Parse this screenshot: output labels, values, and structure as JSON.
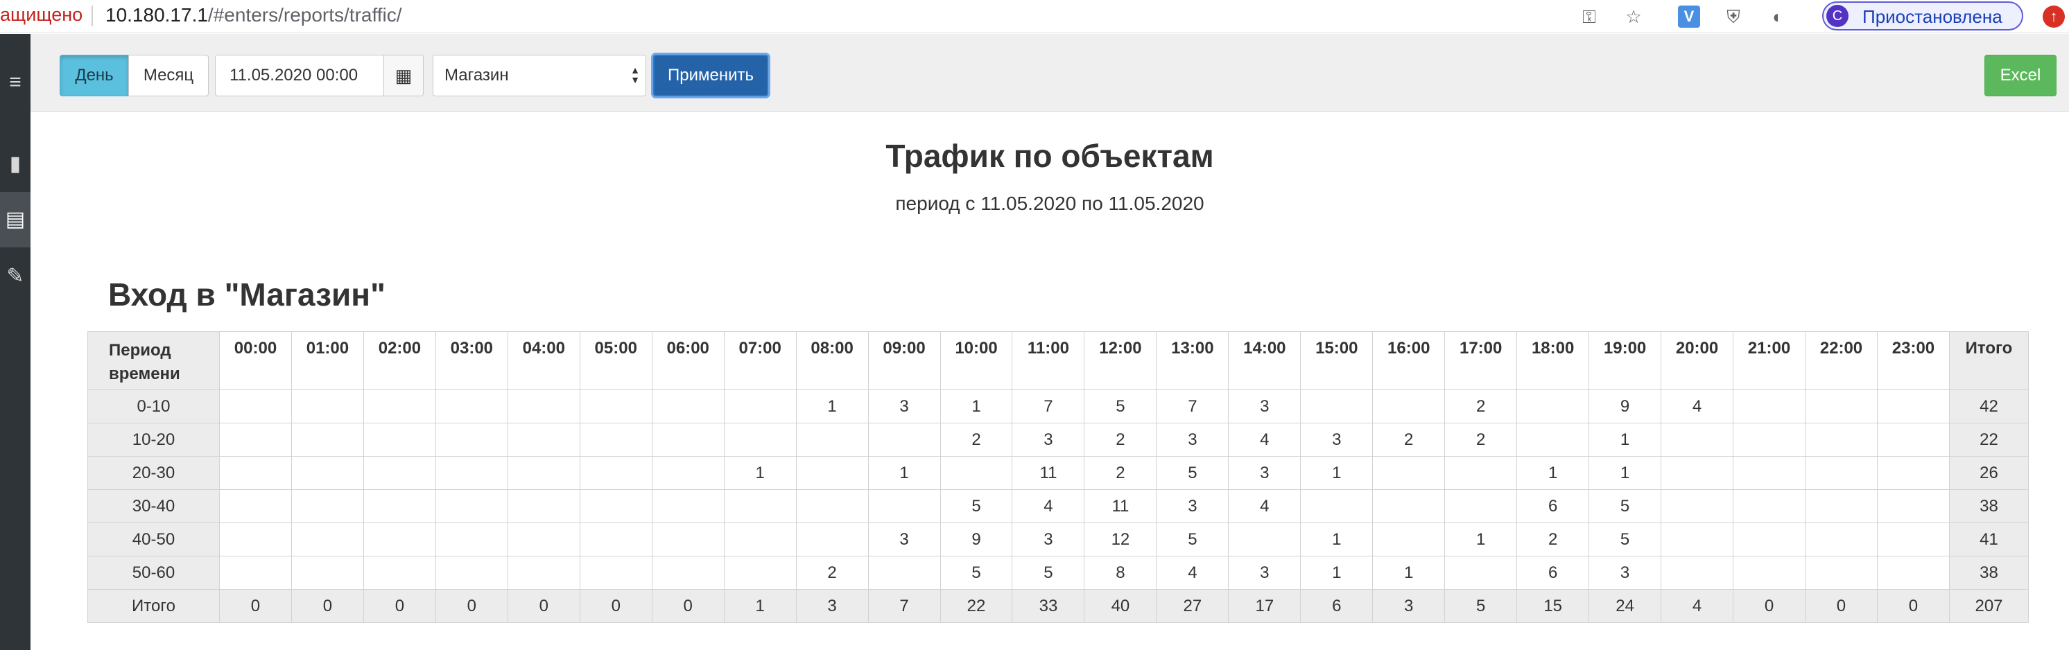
{
  "browser": {
    "security_label": "ащищено",
    "url_host": "10.180.17.1",
    "url_path": "/#enters/reports/traffic/",
    "profile_initial": "С",
    "profile_label": "Приостановлена",
    "ext_v_label": "V"
  },
  "toolbar": {
    "day_label": "День",
    "month_label": "Месяц",
    "date_value": "11.05.2020 00:00",
    "select_value": "Магазин",
    "apply_label": "Применить",
    "excel_label": "Excel"
  },
  "report": {
    "title": "Трафик по объектам",
    "subtitle": "период с 11.05.2020 по 11.05.2020",
    "section_title": "Вход в \"Магазин\""
  },
  "table": {
    "period_header_line1": "Период",
    "period_header_line2": "времени",
    "hours": [
      "00:00",
      "01:00",
      "02:00",
      "03:00",
      "04:00",
      "05:00",
      "06:00",
      "07:00",
      "08:00",
      "09:00",
      "10:00",
      "11:00",
      "12:00",
      "13:00",
      "14:00",
      "15:00",
      "16:00",
      "17:00",
      "18:00",
      "19:00",
      "20:00",
      "21:00",
      "22:00",
      "23:00"
    ],
    "total_header": "Итого",
    "rows": [
      {
        "label": "0-10",
        "cells": [
          "",
          "",
          "",
          "",
          "",
          "",
          "",
          "",
          "1",
          "3",
          "1",
          "7",
          "5",
          "7",
          "3",
          "",
          "",
          "2",
          "",
          "9",
          "4",
          "",
          "",
          ""
        ],
        "total": "42"
      },
      {
        "label": "10-20",
        "cells": [
          "",
          "",
          "",
          "",
          "",
          "",
          "",
          "",
          "",
          "",
          "2",
          "3",
          "2",
          "3",
          "4",
          "3",
          "2",
          "2",
          "",
          "1",
          "",
          "",
          "",
          ""
        ],
        "total": "22"
      },
      {
        "label": "20-30",
        "cells": [
          "",
          "",
          "",
          "",
          "",
          "",
          "",
          "1",
          "",
          "1",
          "",
          "11",
          "2",
          "5",
          "3",
          "1",
          "",
          "",
          "1",
          "1",
          "",
          "",
          "",
          ""
        ],
        "total": "26"
      },
      {
        "label": "30-40",
        "cells": [
          "",
          "",
          "",
          "",
          "",
          "",
          "",
          "",
          "",
          "",
          "5",
          "4",
          "11",
          "3",
          "4",
          "",
          "",
          "",
          "6",
          "5",
          "",
          "",
          "",
          ""
        ],
        "total": "38"
      },
      {
        "label": "40-50",
        "cells": [
          "",
          "",
          "",
          "",
          "",
          "",
          "",
          "",
          "",
          "3",
          "9",
          "3",
          "12",
          "5",
          "",
          "1",
          "",
          "1",
          "2",
          "5",
          "",
          "",
          "",
          ""
        ],
        "total": "41"
      },
      {
        "label": "50-60",
        "cells": [
          "",
          "",
          "",
          "",
          "",
          "",
          "",
          "",
          "2",
          "",
          "5",
          "5",
          "8",
          "4",
          "3",
          "1",
          "1",
          "",
          "6",
          "3",
          "",
          "",
          "",
          ""
        ],
        "total": "38"
      }
    ],
    "sum_row": {
      "label": "Итого",
      "cells": [
        "0",
        "0",
        "0",
        "0",
        "0",
        "0",
        "0",
        "1",
        "3",
        "7",
        "22",
        "33",
        "40",
        "27",
        "17",
        "6",
        "3",
        "5",
        "15",
        "24",
        "4",
        "0",
        "0",
        "0"
      ],
      "total": "207"
    }
  }
}
